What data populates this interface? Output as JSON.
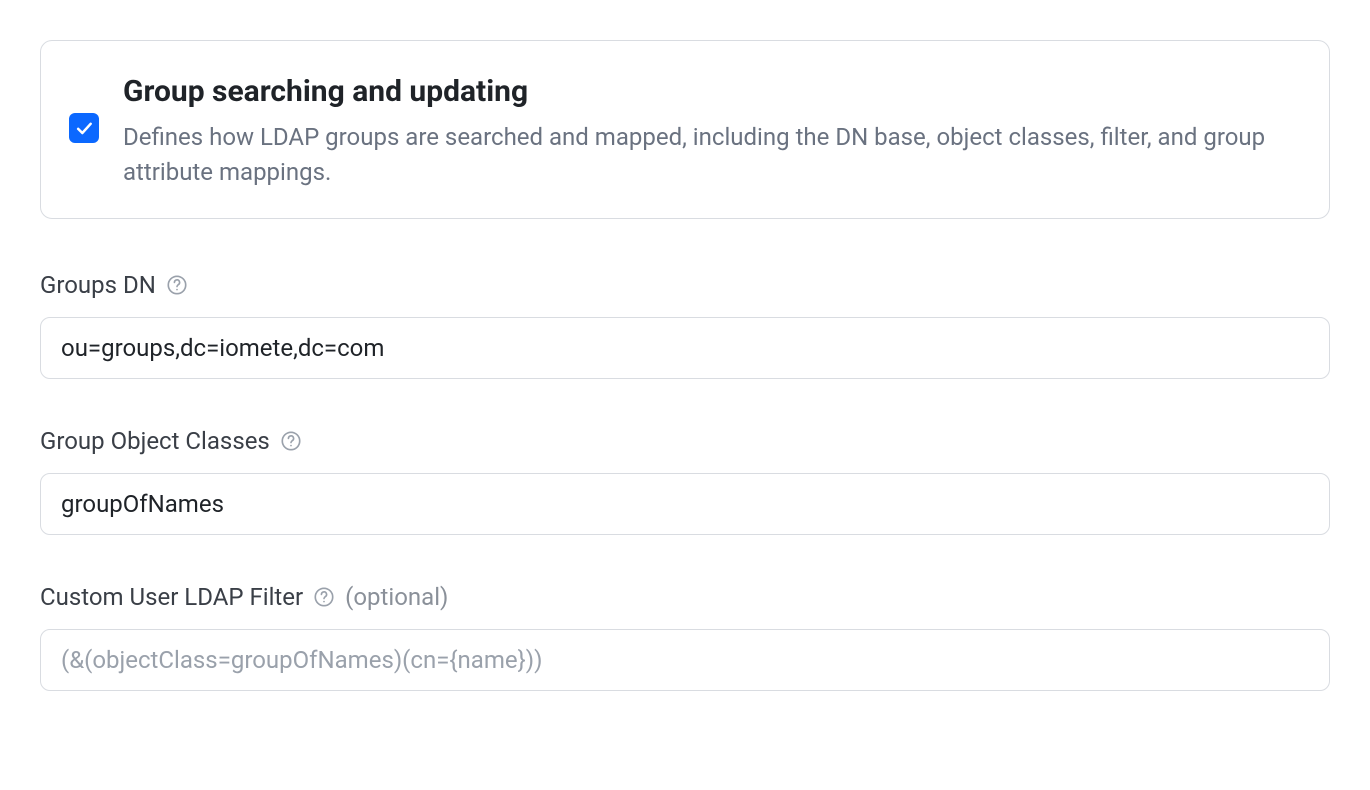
{
  "card": {
    "checked": true,
    "title": "Group searching and updating",
    "description": "Defines how LDAP groups are searched and mapped, including the DN base, object classes, filter, and group attribute mappings."
  },
  "fields": {
    "groupsDn": {
      "label": "Groups DN",
      "value": "ou=groups,dc=iomete,dc=com"
    },
    "groupObjectClasses": {
      "label": "Group Object Classes",
      "value": "groupOfNames"
    },
    "customFilter": {
      "label": "Custom User LDAP Filter",
      "optional": "(optional)",
      "placeholder": "(&(objectClass=groupOfNames)(cn={name}))",
      "value": ""
    }
  }
}
